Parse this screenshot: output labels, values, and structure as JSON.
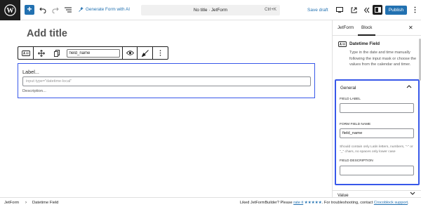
{
  "colors": {
    "accent": "#2271b1",
    "highlight": "#3858e9",
    "dark": "#1e1e1e"
  },
  "topbar": {
    "logo_icon": "wordpress-logo",
    "add_icon": "plus-icon",
    "undo_icon": "undo-icon",
    "redo_icon": "redo-icon",
    "list_view_icon": "list-view-icon",
    "generate_ai_label": "Generate Form with AI",
    "document_title": "No title · JetForm",
    "shortcut": "Ctrl+K",
    "save_draft_label": "Save draft",
    "preview_icon": "desktop-preview-icon",
    "view_icon": "external-view-icon",
    "back_icon": "chevrons-left-icon",
    "settings_icon": "settings-panel-icon",
    "publish_label": "Publish",
    "options_icon": "more-vertical-icon"
  },
  "editor": {
    "title_placeholder": "Add title",
    "toolbar": {
      "block_icon": "datetime-field-icon",
      "move_icon": "move-icon",
      "copy_icon": "copy-icon",
      "field_name_value": "field_name",
      "visibility_icon": "eye-icon",
      "style_icon": "paint-brush-icon",
      "more_icon": "more-vertical-icon"
    },
    "field": {
      "label_placeholder": "Label...",
      "input_placeholder": "input type=\"datetime-local\"",
      "description_placeholder": "Description..."
    }
  },
  "sidebar": {
    "tabs": [
      "JetForm",
      "Block"
    ],
    "active_tab": "Block",
    "close_icon": "close-icon",
    "block_name": "Datetime Field",
    "block_icon": "datetime-field-icon",
    "block_description": "Type in the date and time manually following the input mask or choose the values from the calendar and timer.",
    "general_panel": {
      "title": "General",
      "field_label_caption": "FIELD LABEL",
      "field_label_value": "",
      "form_field_name_caption": "FORM FIELD NAME",
      "form_field_name_value": "field_name",
      "field_name_help": "Should contain only Latin letters, numbers, \"-\" or \"_\" chars, no spaces only lower case",
      "field_description_caption": "FIELD DESCRIPTION",
      "field_description_value": ""
    },
    "value_panel_title": "Value"
  },
  "footer": {
    "breadcrumb": [
      "JetForm",
      "Datetime Field"
    ],
    "rating_prefix": "Liked JetFormBuilder? Please",
    "rating_link": "rate it",
    "rating_stars": "★★★★★",
    "support_prefix": ". For troubleshooting, contact",
    "support_link": "Crocoblock support",
    "support_suffix": "."
  }
}
